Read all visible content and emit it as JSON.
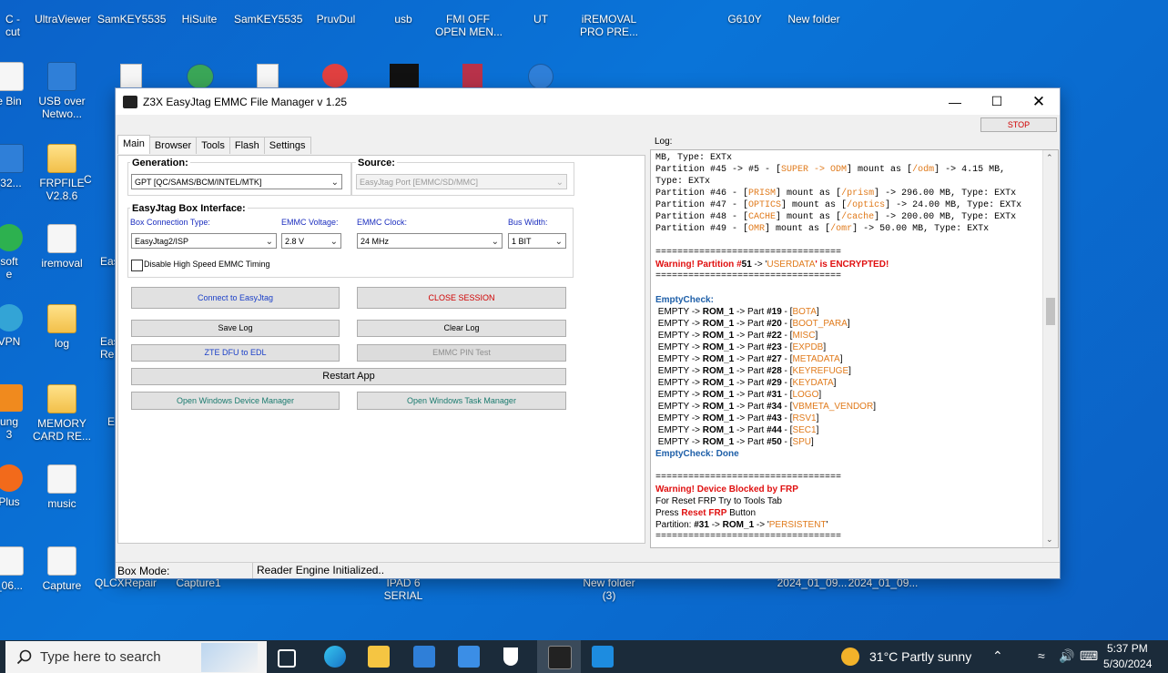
{
  "desktop": {
    "top_row": [
      "C -\ncut",
      "UltraViewer",
      "SamKEY5535",
      "HiSuite",
      "SamKEY5535",
      "PruvDul",
      "usb",
      "FMI OFF\nOPEN MEN...",
      "UT",
      "iREMOVAL\nPRO PRE...",
      "G610Y",
      "New folder"
    ],
    "left_col": [
      "e Bin",
      "soft\ne",
      "VPN",
      "ung\n3",
      "Plus",
      "_06..."
    ],
    "col2": [
      "USB over\nNetwo...",
      "FRPFILE\nV2.8.6",
      "iremoval",
      "log",
      "MEMORY\nCARD RE...",
      "music",
      "Capture"
    ],
    "col3_partial": [
      "C",
      "Eas",
      "Eas\nRe",
      "E"
    ],
    "bottom_row": [
      "QLCXRepair",
      "Capture1",
      "IPAD 6\nSERIAL",
      "New folder\n(3)",
      "2024_01_09...",
      "2024_01_09..."
    ]
  },
  "window": {
    "title": "Z3X EasyJtag EMMC File Manager v 1.25",
    "stop_label": "STOP",
    "tabs": [
      "Main",
      "Browser",
      "Tools",
      "Flash",
      "Settings"
    ],
    "generation": {
      "label": "Generation:",
      "value": "GPT [QC/SAMS/BCM/INTEL/MTK]"
    },
    "source": {
      "label": "Source:",
      "value": "EasyJtag Port [EMMC/SD/MMC]"
    },
    "box_interface": {
      "label": "EasyJtag Box Interface:",
      "connection_type_label": "Box Connection Type:",
      "connection_type_value": "EasyJtag2/ISP",
      "voltage_label": "EMMC Voltage:",
      "voltage_value": "2.8 V",
      "clock_label": "EMMC Clock:",
      "clock_value": "24 MHz",
      "bus_label": "Bus Width:",
      "bus_value": "1 BIT",
      "disable_hs_label": "Disable High Speed EMMC Timing"
    },
    "buttons": {
      "connect": "Connect to EasyJtag",
      "close_session": "CLOSE SESSION",
      "save_log": "Save Log",
      "clear_log": "Clear Log",
      "zte_dfu": "ZTE DFU to EDL",
      "emmc_pin": "EMMC PIN Test",
      "restart": "Restart App",
      "device_manager": "Open Windows Device Manager",
      "task_manager": "Open Windows Task Manager"
    },
    "log_label": "Log:",
    "log": {
      "l1": "MB, Type: EXTx",
      "l2a": "Partition #45 -> #5 - [",
      "l2b": "SUPER -> ODM",
      "l2c": "] mount as [",
      "l2d": "/odm",
      "l2e": "] -> 4.15 MB,",
      "l3": "Type: EXTx",
      "p46a": "Partition #46 - [",
      "p46b": "PRISM",
      "p46c": "] mount as [",
      "p46d": "/prism",
      "p46e": "] -> 296.00 MB, Type: EXTx",
      "p47a": "Partition #47 - [",
      "p47b": "OPTICS",
      "p47c": "] mount as [",
      "p47d": "/optics",
      "p47e": "] -> 24.00 MB, Type: EXTx",
      "p48a": "Partition #48 - [",
      "p48b": "CACHE",
      "p48c": "] mount as [",
      "p48d": "/cache",
      "p48e": "] -> 200.00 MB, Type: EXTx",
      "p49a": "Partition #49 - [",
      "p49b": "OMR",
      "p49c": "] mount as [",
      "p49d": "/omr",
      "p49e": "] -> 50.00 MB, Type: EXTx",
      "sep": "==================================",
      "warn1a": "Warning! Partition #",
      "warn1b": "51",
      "warn1c": " -> '",
      "warn1d": "USERDATA",
      "warn1e": "' is ENCRYPTED!",
      "empty_title": "EmptyCheck:",
      "empty_prefix": " EMPTY -> ",
      "empty_rom": "ROM_1",
      "empty_part": " -> Part ",
      "empty_rows": [
        {
          "n": "#19",
          "name": "BOTA"
        },
        {
          "n": "#20",
          "name": "BOOT_PARA"
        },
        {
          "n": "#22",
          "name": "MISC"
        },
        {
          "n": "#23",
          "name": "EXPDB"
        },
        {
          "n": "#27",
          "name": "METADATA"
        },
        {
          "n": "#28",
          "name": "KEYREFUGE"
        },
        {
          "n": "#29",
          "name": "KEYDATA"
        },
        {
          "n": "#31",
          "name": "LOGO"
        },
        {
          "n": "#34",
          "name": "VBMETA_VENDOR"
        },
        {
          "n": "#43",
          "name": "RSV1"
        },
        {
          "n": "#44",
          "name": "SEC1"
        },
        {
          "n": "#50",
          "name": "SPU"
        }
      ],
      "empty_done": "EmptyCheck: Done",
      "frp_title": "Warning! Device Blocked by FRP",
      "frp_l1": "For Reset FRP Try to Tools Tab",
      "frp_l2a": "Press ",
      "frp_l2b": "Reset FRP",
      "frp_l2c": " Button",
      "frp_l3a": "Partition: ",
      "frp_l3b": "#31",
      "frp_l3c": " -> ",
      "frp_l3d": "ROM_1",
      "frp_l3e": " -> '",
      "frp_l3f": "PERSISTENT",
      "frp_l3g": "'"
    },
    "status": {
      "box_mode": "Box Mode:",
      "message": "Reader Engine Initialized.."
    }
  },
  "taskbar": {
    "search_placeholder": "Type here to search",
    "weather": "31°C  Partly sunny",
    "time": "5:37 PM",
    "date": "5/30/2024"
  }
}
